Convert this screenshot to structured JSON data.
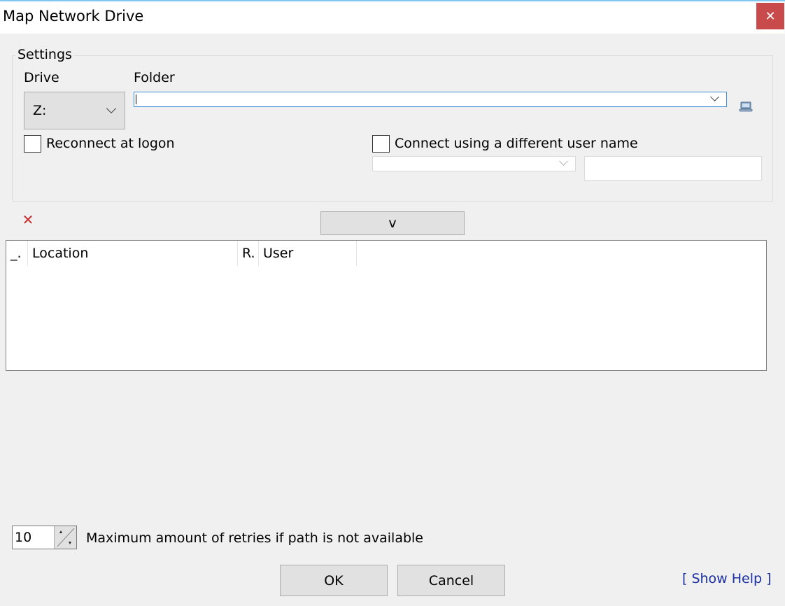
{
  "window": {
    "title": "Map Network Drive",
    "close_icon": "close-icon",
    "close_glyph": "✕"
  },
  "settings": {
    "legend": "Settings",
    "drive_label": "Drive",
    "drive_value": "Z:",
    "folder_label": "Folder",
    "folder_value": "",
    "browse_icon": "network-computer-icon",
    "reconnect_label": "Reconnect at logon",
    "reconnect_checked": false,
    "different_user_label": "Connect using a different user name",
    "different_user_checked": false,
    "user_name_value": "",
    "password_value": ""
  },
  "mappings": {
    "delete_glyph": "✕",
    "delete_icon": "delete-icon",
    "add_button_label": "v",
    "columns": [
      "_.",
      "Location",
      "R.",
      "User"
    ],
    "rows": []
  },
  "retries": {
    "value": "10",
    "label": "Maximum amount of retries if path is not available"
  },
  "buttons": {
    "ok": "OK",
    "cancel": "Cancel",
    "help": "[ Show Help ]"
  },
  "colors": {
    "close_button": "#c84a4a",
    "delete_icon": "#c42b2b",
    "help_link": "#1a2fa0",
    "title_accent": "#7ec7f0"
  }
}
